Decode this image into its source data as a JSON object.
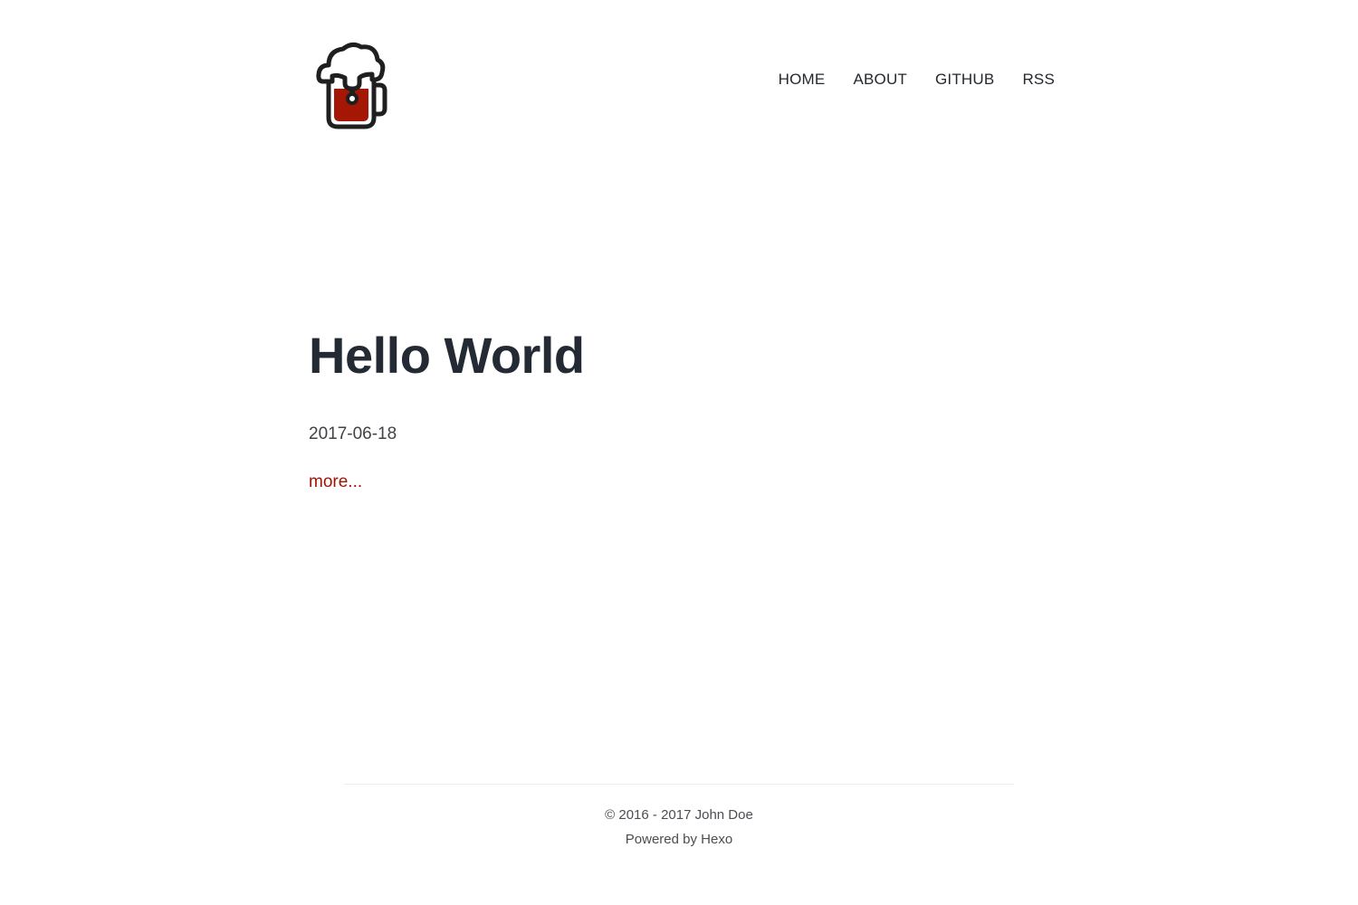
{
  "header": {
    "logo_icon": "beer-mug-icon",
    "nav": [
      {
        "label": "HOME"
      },
      {
        "label": "ABOUT"
      },
      {
        "label": "GITHUB"
      },
      {
        "label": "RSS"
      }
    ]
  },
  "post": {
    "title": "Hello World",
    "date": "2017-06-18",
    "more_label": "more..."
  },
  "footer": {
    "copyright": "© 2016 - 2017 John Doe",
    "powered_prefix": "Powered by ",
    "powered_link": "Hexo"
  },
  "colors": {
    "accent": "#a01505",
    "text": "#25282c",
    "beer": "#a31704"
  }
}
